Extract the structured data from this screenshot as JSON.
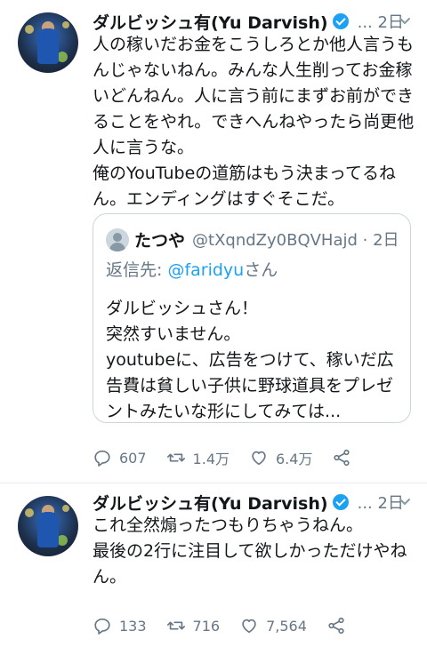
{
  "tweets": [
    {
      "author_name": "ダルビッシュ有(Yu Darvish)",
      "meta": "... 2日",
      "text": "人の稼いだお金をこうしろとか他人言うもんじゃないねん。みんな人生削ってお金稼いどんねん。人に言う前にまずお前ができることをやれ。できへんねやったら尚更他人に言うな。\n俺のYouTubeの道筋はもう決まってるねん。エンディングはすぐそこだ。",
      "quote": {
        "author_name": "たつや",
        "handle_time": "@tXqndZy0BQVHajd · 2日",
        "reply_prefix": "返信先: ",
        "reply_mention": "@faridyu",
        "reply_suffix": "さん",
        "text": "ダルビッシュさん！\n突然すいません。\nyoutubeに、広告をつけて、稼いだ広告費は貧しい子供に野球道具をプレゼントみたいな形にしてみては..."
      },
      "replies": "607",
      "retweets": "1.4万",
      "likes": "6.4万"
    },
    {
      "author_name": "ダルビッシュ有(Yu Darvish)",
      "meta": "... 2日",
      "text": "これ全然煽ったつもりちゃうねん。\n最後の2行に注目して欲しかっただけやねん。",
      "replies": "133",
      "retweets": "716",
      "likes": "7,564"
    }
  ],
  "icons": {
    "verified": "verified-badge-icon",
    "chevron": "chevron-down-icon",
    "reply": "reply-icon",
    "retweet": "retweet-icon",
    "like": "heart-icon",
    "share": "share-icon"
  },
  "colors": {
    "accent": "#1da1f2",
    "secondary_text": "#657786",
    "border": "#ccd6dd"
  }
}
